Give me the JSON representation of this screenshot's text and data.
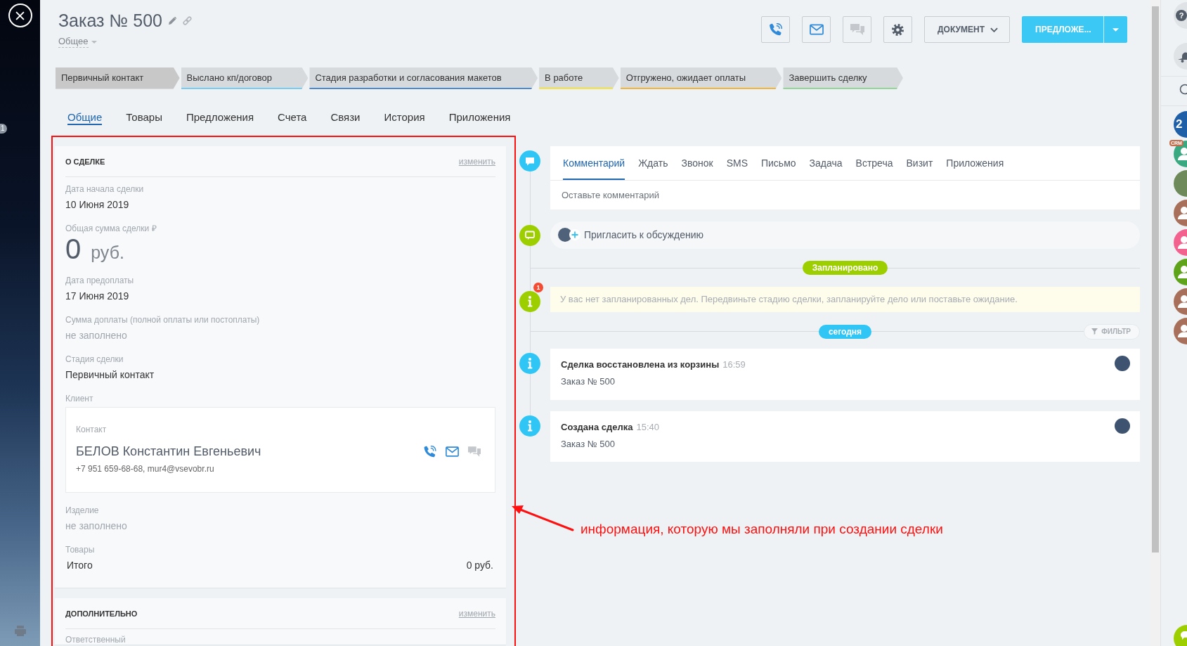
{
  "left_rail": {
    "counter": "1"
  },
  "header": {
    "title": "Заказ № 500",
    "category": "Общее",
    "icon_buttons": [
      {
        "kind": "phone",
        "disabled": false
      },
      {
        "kind": "mail",
        "disabled": false
      },
      {
        "kind": "chat",
        "disabled": true
      },
      {
        "kind": "settings",
        "disabled": false
      }
    ],
    "document_button": "ДОКУМЕНТ",
    "primary_button": "ПРЕДЛОЖЕ..."
  },
  "stages": [
    {
      "label": "Первичный контакт",
      "selected": true,
      "color": "#c8c8c8"
    },
    {
      "label": "Выслано кп/договор",
      "selected": false,
      "color": "#55c7f7"
    },
    {
      "label": "Стадия разработки и согласования макетов",
      "selected": false,
      "color": "#1e6ec8"
    },
    {
      "label": "В работе",
      "selected": false,
      "color": "#ffe600"
    },
    {
      "label": "Отгружено, ожидает оплаты",
      "selected": false,
      "color": "#f7a700"
    },
    {
      "label": "Завершить сделку",
      "selected": false,
      "color": "#7bd17d"
    }
  ],
  "tabs": [
    {
      "label": "Общие",
      "selected": true
    },
    {
      "label": "Товары",
      "selected": false
    },
    {
      "label": "Предложения",
      "selected": false
    },
    {
      "label": "Счета",
      "selected": false
    },
    {
      "label": "Связи",
      "selected": false
    },
    {
      "label": "История",
      "selected": false
    },
    {
      "label": "Приложения",
      "selected": false
    }
  ],
  "about": {
    "title": "О СДЕЛКЕ",
    "edit": "изменить",
    "fields": [
      {
        "kind": "text",
        "label": "Дата начала сделки",
        "value": "10 Июня 2019",
        "empty": false
      },
      {
        "kind": "amount",
        "label": "Общая сумма сделки ₽",
        "amount": "0",
        "currency": "руб."
      },
      {
        "kind": "text",
        "label": "Дата предоплаты",
        "value": "17 Июня 2019",
        "empty": false
      },
      {
        "kind": "text",
        "label": "Сумма доплаты (полной оплаты или постоплаты)",
        "value": "не заполнено",
        "empty": true
      },
      {
        "kind": "text",
        "label": "Стадия сделки",
        "value": "Первичный контакт",
        "empty": false
      },
      {
        "kind": "client",
        "label": "Клиент",
        "contact_type": "Контакт",
        "name": "БЕЛОВ Константин Евгеньевич",
        "details": "+7 951 659-68-68, mur4@vsevobr.ru",
        "actions": [
          {
            "kind": "phone",
            "disabled": false
          },
          {
            "kind": "mail",
            "disabled": false
          },
          {
            "kind": "chat",
            "disabled": true
          }
        ]
      },
      {
        "kind": "text",
        "label": "Изделие",
        "value": "не заполнено",
        "empty": true
      },
      {
        "kind": "total",
        "label": "Товары",
        "total_label": "Итого",
        "total_value": "0 руб."
      }
    ]
  },
  "extra": {
    "title": "ДОПОЛНИТЕЛЬНО",
    "edit": "изменить",
    "fields": [
      {
        "label": "Ответственный"
      }
    ]
  },
  "timeline": {
    "editor": {
      "tabs": [
        {
          "label": "Комментарий",
          "selected": true
        },
        {
          "label": "Ждать",
          "selected": false
        },
        {
          "label": "Звонок",
          "selected": false
        },
        {
          "label": "SMS",
          "selected": false
        },
        {
          "label": "Письмо",
          "selected": false
        },
        {
          "label": "Задача",
          "selected": false
        },
        {
          "label": "Встреча",
          "selected": false
        },
        {
          "label": "Визит",
          "selected": false
        },
        {
          "label": "Приложения",
          "selected": false
        }
      ],
      "placeholder": "Оставьте комментарий"
    },
    "invite": "Пригласить к обсуждению",
    "planned": "Запланировано",
    "notice": {
      "text": "У вас нет запланированных дел. Передвиньте стадию сделки, запланируйте дело или поставьте ожидание.",
      "badge": "1"
    },
    "today": "сегодня",
    "filter": "ФИЛЬТР",
    "events": [
      {
        "title": "Сделка восстановлена из корзины",
        "time": "16:59",
        "subtitle": "Заказ № 500"
      },
      {
        "title": "Создана сделка",
        "time": "15:40",
        "subtitle": "Заказ № 500"
      }
    ]
  },
  "annotation": {
    "text": "информация, которую мы заполняли при создании сделки"
  },
  "right_bar": {
    "help": "?",
    "chats": [
      {
        "kind": "text",
        "text": "2",
        "color": "#1f5fa8"
      },
      {
        "kind": "user",
        "color": "#3aa981",
        "badge": "CRM"
      },
      {
        "kind": "photo"
      },
      {
        "kind": "user",
        "color": "#a8705a"
      },
      {
        "kind": "user",
        "color": "#f3628f"
      },
      {
        "kind": "user",
        "color": "#5ea31a"
      },
      {
        "kind": "user",
        "color": "#a8705a"
      },
      {
        "kind": "user",
        "color": "#a8705a"
      }
    ]
  }
}
